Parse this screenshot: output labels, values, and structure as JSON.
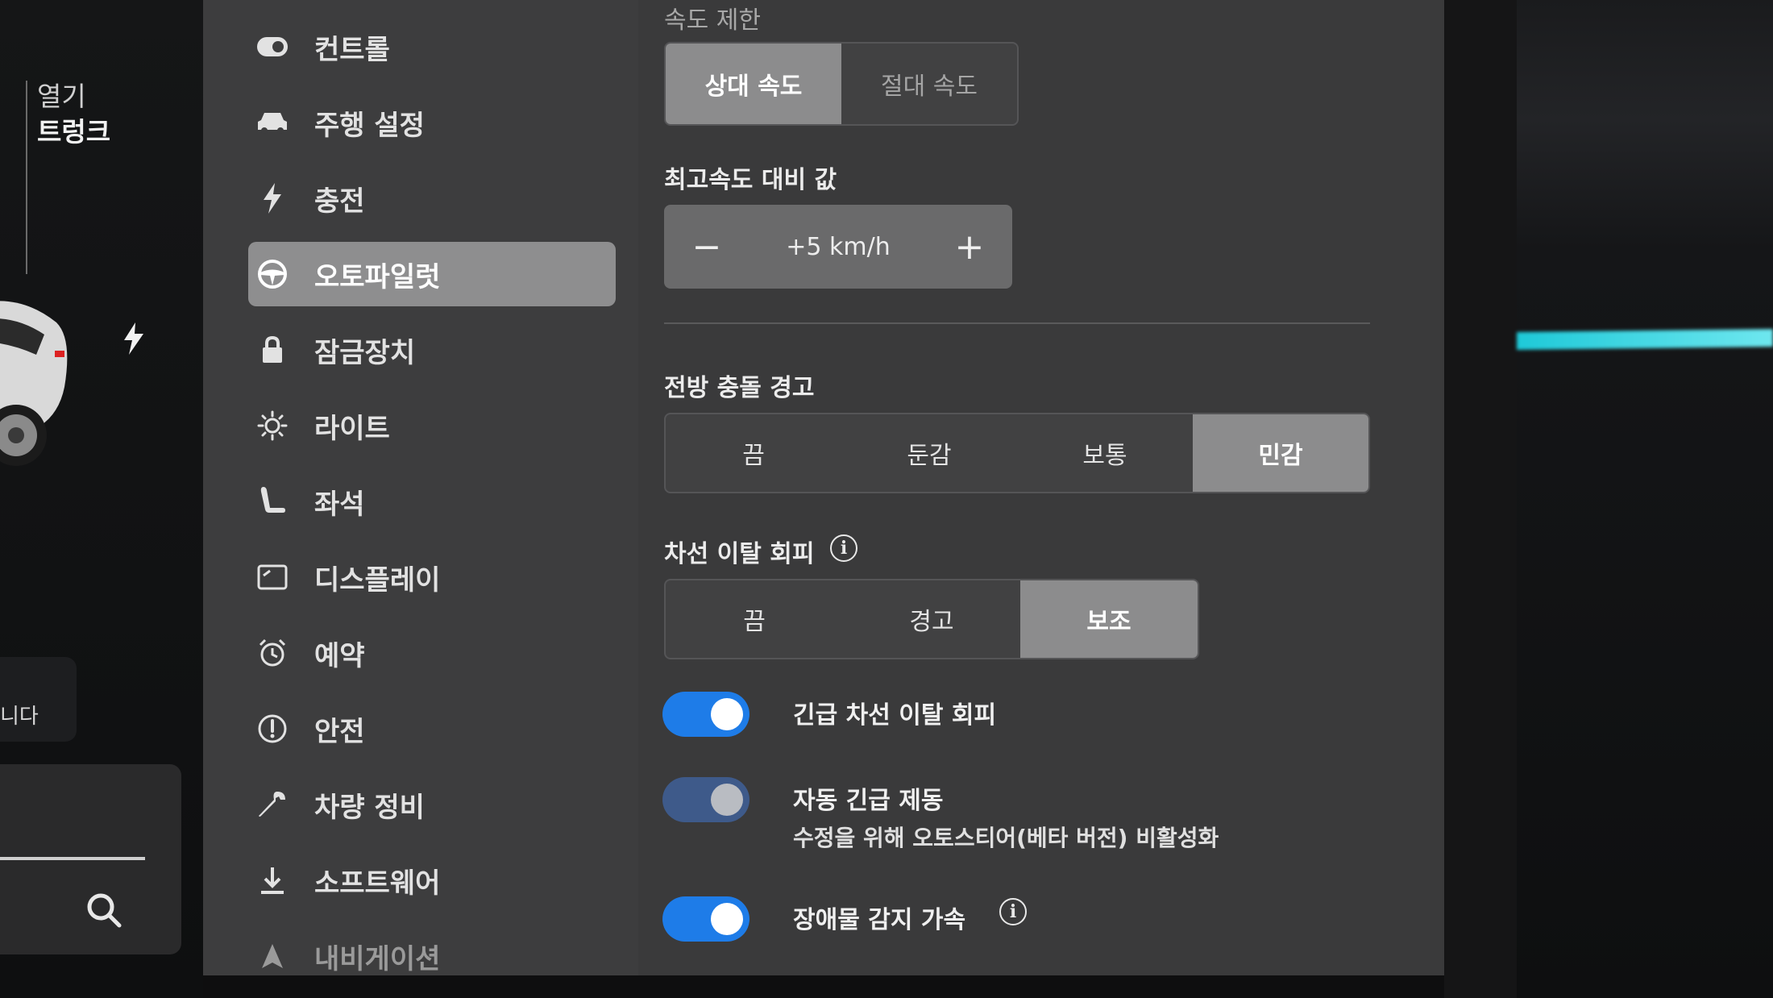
{
  "left_panel": {
    "trunk_open_label": "열기",
    "trunk_label": "트렁크",
    "notice_text": "니다"
  },
  "nav": {
    "items": [
      {
        "label": "컨트롤",
        "icon": "toggle-icon"
      },
      {
        "label": "주행 설정",
        "icon": "car-icon"
      },
      {
        "label": "충전",
        "icon": "lightning-icon"
      },
      {
        "label": "오토파일럿",
        "icon": "steering-wheel-icon",
        "active": true
      },
      {
        "label": "잠금장치",
        "icon": "lock-icon"
      },
      {
        "label": "라이트",
        "icon": "sun-icon"
      },
      {
        "label": "좌석",
        "icon": "seat-icon"
      },
      {
        "label": "디스플레이",
        "icon": "display-icon"
      },
      {
        "label": "예약",
        "icon": "alarm-clock-icon"
      },
      {
        "label": "안전",
        "icon": "alert-circle-icon"
      },
      {
        "label": "차량 정비",
        "icon": "wrench-icon"
      },
      {
        "label": "소프트웨어",
        "icon": "download-icon"
      },
      {
        "label": "내비게이션",
        "icon": "navigation-arrow-icon"
      }
    ]
  },
  "speed_limit": {
    "title": "속도 제한",
    "options": [
      "상대 속도",
      "절대 속도"
    ],
    "selected": "상대 속도"
  },
  "speed_offset": {
    "title": "최고속도 대비 값",
    "value": "+5 km/h",
    "decrement": "−",
    "increment": "+"
  },
  "forward_collision": {
    "title": "전방 충돌 경고",
    "options": [
      "끔",
      "둔감",
      "보통",
      "민감"
    ],
    "selected": "민감"
  },
  "lane_departure": {
    "title": "차선 이탈 회피",
    "info": "i",
    "options": [
      "끔",
      "경고",
      "보조"
    ],
    "selected": "보조"
  },
  "toggles": {
    "emergency_lane": {
      "label": "긴급 차선 이탈 회피",
      "state": "on"
    },
    "auto_emergency_braking": {
      "label": "자동 긴급 제동",
      "sublabel": "수정을 위해 오토스티어(베타 버전) 비활성화",
      "state": "on-disabled"
    },
    "obstacle_accel": {
      "label": "장애물 감지 가속",
      "info": "i",
      "state": "on"
    }
  },
  "colors": {
    "toggle_on": "#1e7ce8",
    "ambient_light": "#1ec9d8",
    "selected_segment": "#8c8c8d"
  }
}
